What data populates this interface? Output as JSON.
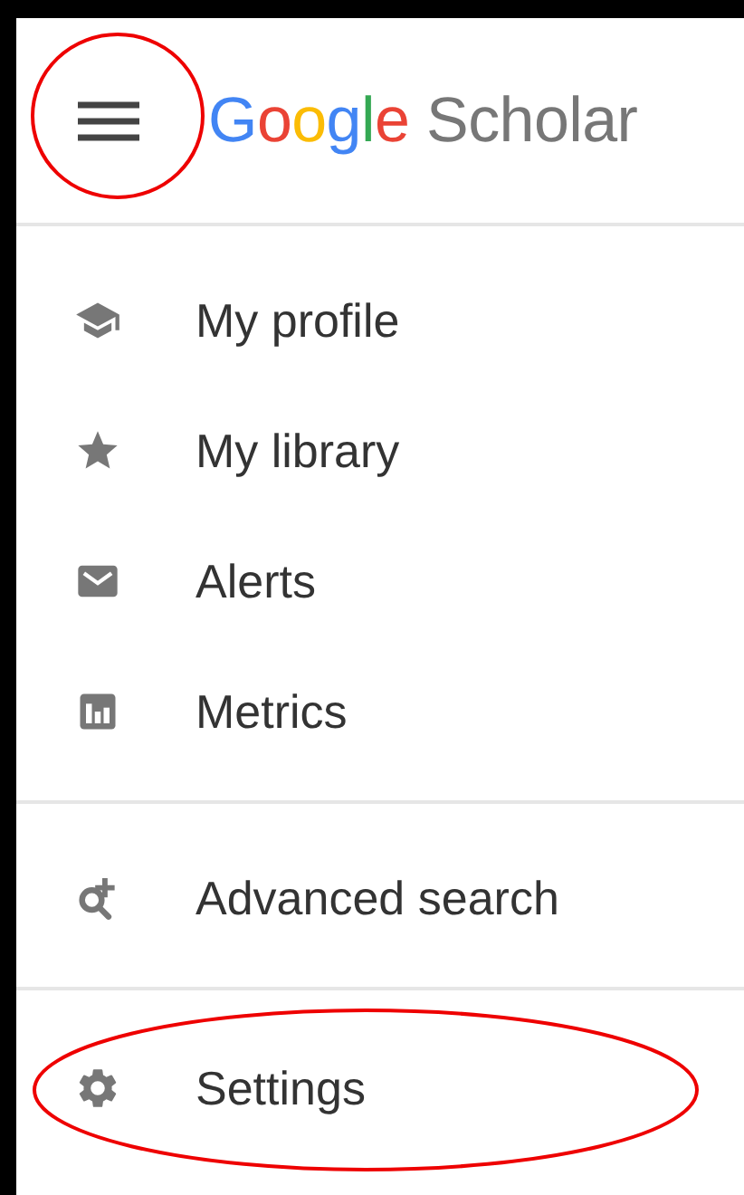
{
  "header": {
    "menu_button": {
      "circled": true
    },
    "logo": {
      "brand": "Google",
      "product": "Scholar"
    }
  },
  "sections": [
    {
      "items": [
        {
          "label": "My profile",
          "circled": false
        },
        {
          "label": "My library",
          "circled": false
        },
        {
          "label": "Alerts",
          "circled": false
        },
        {
          "label": "Metrics",
          "circled": false
        }
      ]
    },
    {
      "items": [
        {
          "label": "Advanced search",
          "circled": false
        }
      ]
    },
    {
      "items": [
        {
          "label": "Settings",
          "circled": true
        }
      ]
    }
  ]
}
